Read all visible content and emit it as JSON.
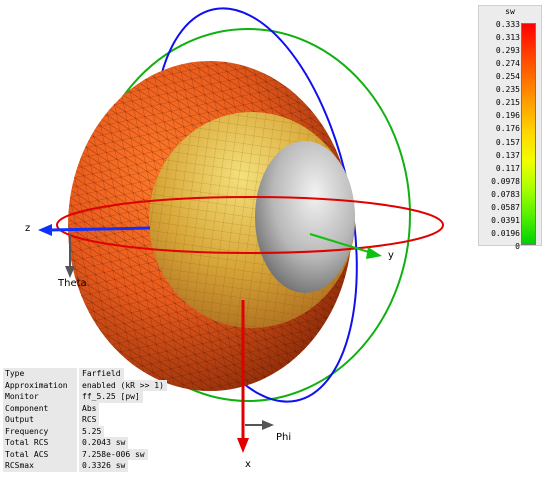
{
  "legend": {
    "unit": "sw",
    "labels": [
      "0.333",
      "0.313",
      "0.293",
      "0.274",
      "0.254",
      "0.235",
      "0.215",
      "0.196",
      "0.176",
      "0.157",
      "0.137",
      "0.117",
      "0.0978",
      "0.0783",
      "0.0587",
      "0.0391",
      "0.0196",
      "0"
    ],
    "gradient_colors": [
      "#ff0000",
      "#ff3a00",
      "#ff7000",
      "#ffa600",
      "#ffd800",
      "#f0ff00",
      "#a8ff00",
      "#50f000",
      "#00d000"
    ]
  },
  "axes": {
    "z_label": "z",
    "y_label": "y",
    "x_label": "x",
    "theta_label": "Theta",
    "phi_label": "Phi"
  },
  "info": [
    {
      "key": "Type",
      "value": "Farfield"
    },
    {
      "key": "Approximation",
      "value": "enabled (kR >> 1)"
    },
    {
      "key": "Monitor",
      "value": "ff_5.25 [pw]"
    },
    {
      "key": "Component",
      "value": "Abs"
    },
    {
      "key": "Output",
      "value": "RCS"
    },
    {
      "key": "Frequency",
      "value": "5.25"
    },
    {
      "key": "Total RCS",
      "value": "0.2043 sw"
    },
    {
      "key": "Total ACS",
      "value": "7.258e-006 sw"
    },
    {
      "key": "RCSmax",
      "value": "0.3326 sw"
    }
  ]
}
